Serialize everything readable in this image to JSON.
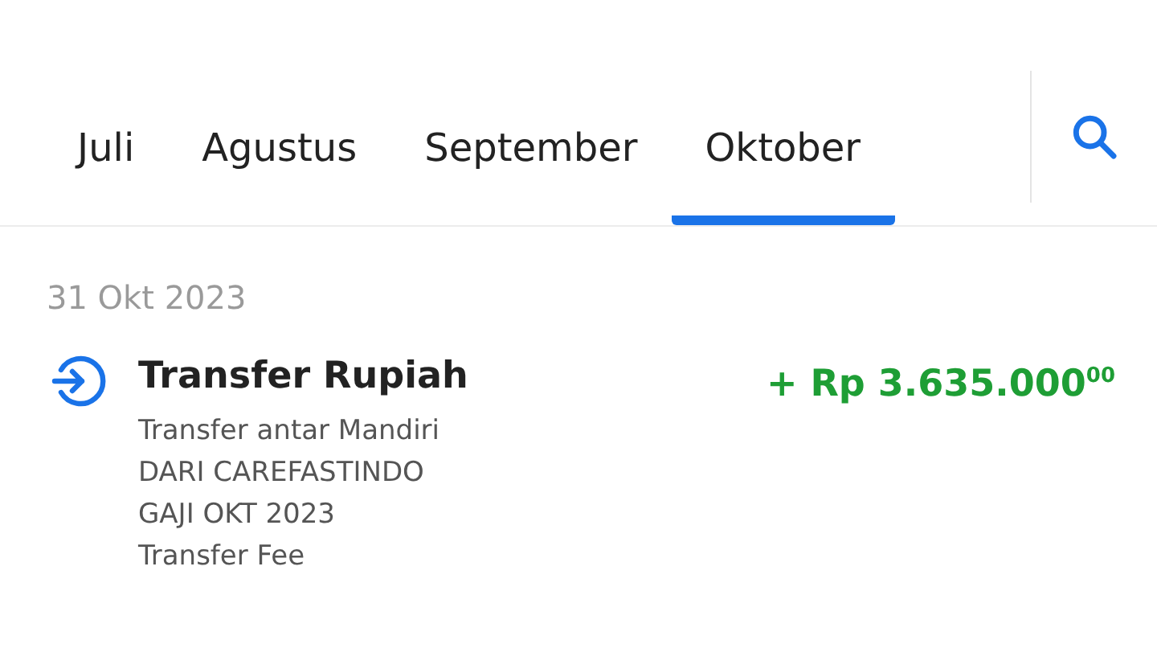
{
  "tabs": [
    {
      "label": "Juli",
      "selected": false
    },
    {
      "label": "Agustus",
      "selected": false
    },
    {
      "label": "September",
      "selected": false
    },
    {
      "label": "Oktober",
      "selected": true
    }
  ],
  "date": "31 Okt 2023",
  "transactions": [
    {
      "kind": "incoming",
      "title": "Transfer Rupiah",
      "amount": "+ Rp 3.635.000$^{00}$",
      "details": [
        "Transfer antar Mandiri",
        "DARI CAREFASTINDO",
        "GAJI OKT 2023",
        "Transfer Fee"
      ]
    }
  ]
}
